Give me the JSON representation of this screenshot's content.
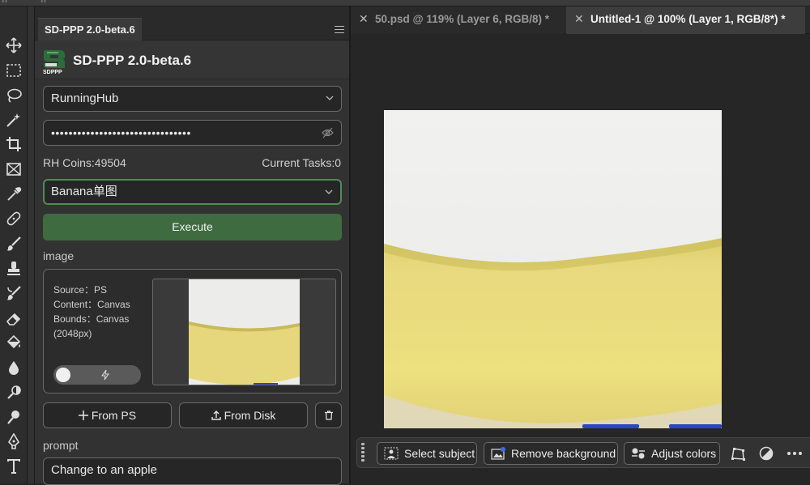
{
  "panel": {
    "tab_label": "SD-PPP 2.0-beta.6",
    "title": "SD-PPP 2.0-beta.6",
    "logo_text": "SDPPP",
    "provider_select": "RunningHub",
    "api_key_masked": "••••••••••••••••••••••••••••••••",
    "coins": "RH Coins:49504",
    "tasks": "Current Tasks:0",
    "workflow_select": "Banana单图",
    "execute_label": "Execute",
    "image_section_label": "image",
    "image_meta": {
      "source": "Source：PS",
      "content": "Content：Canvas",
      "bounds": "Bounds：Canvas",
      "size": "(2048px)"
    },
    "from_ps_label": "From PS",
    "from_disk_label": "From Disk",
    "prompt_section_label": "prompt",
    "prompt_value": "Change to an apple"
  },
  "tabs": [
    {
      "label": "50.psd @ 119% (Layer 6, RGB/8) *",
      "active": false
    },
    {
      "label": "Untitled-1 @ 100% (Layer 1, RGB/8*) *",
      "active": true
    }
  ],
  "context_bar": {
    "select_subject": "Select subject",
    "remove_background": "Remove background",
    "adjust_colors": "Adjust colors"
  },
  "toolbar": {
    "tools": [
      "move-icon",
      "marquee-icon",
      "lasso-icon",
      "magic-wand-icon",
      "crop-icon",
      "frame-icon",
      "eyedropper-icon",
      "healing-brush-icon",
      "brush-icon",
      "clone-stamp-icon",
      "history-brush-icon",
      "eraser-icon",
      "paint-bucket-icon",
      "blur-icon",
      "dodge-icon",
      "sponge-icon",
      "pen-icon",
      "type-icon"
    ]
  },
  "colors": {
    "accent_green": "#3e6b3f",
    "active_border": "#4f8c54",
    "banana_yellow": "#e8d77a",
    "selection_blue": "#2a44c8"
  }
}
